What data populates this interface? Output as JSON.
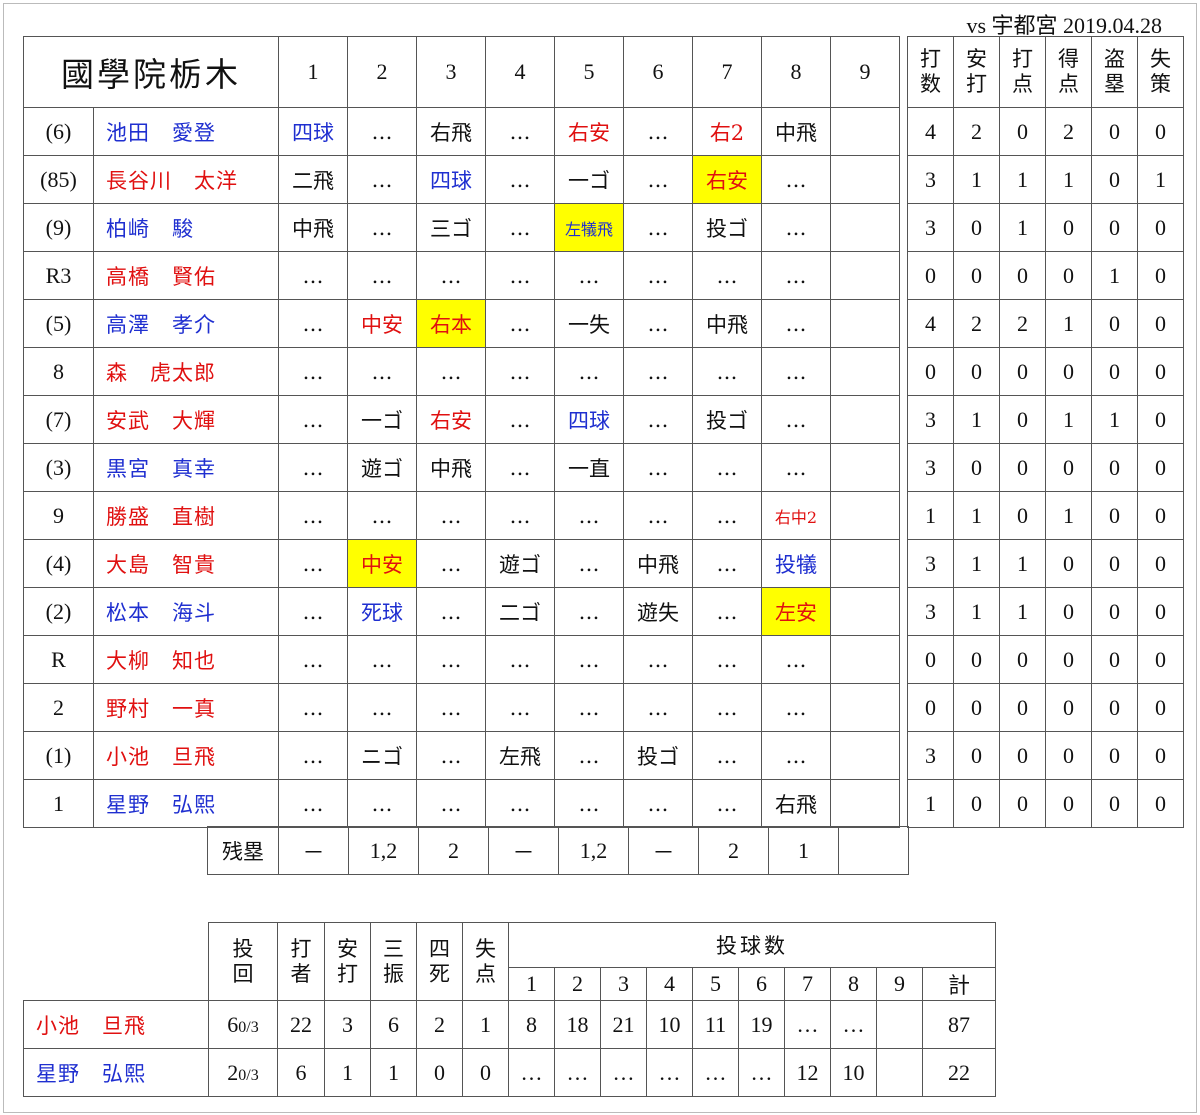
{
  "caption": "vs 宇都宮  2019.04.28",
  "team_name": "國學院栃木",
  "inning_headers": [
    "1",
    "2",
    "3",
    "4",
    "5",
    "6",
    "7",
    "8",
    "9"
  ],
  "stat_headers": [
    "打\n数",
    "安\n打",
    "打\n点",
    "得\n点",
    "盗\n塁",
    "失\n策"
  ],
  "players": [
    {
      "pos": "(6)",
      "name": "池田　愛登",
      "name_color": "b",
      "innings": [
        [
          "四球",
          "b",
          false
        ],
        [
          "…",
          "",
          false
        ],
        [
          "右飛",
          "",
          false
        ],
        [
          "…",
          "",
          false
        ],
        [
          "右安",
          "r",
          false
        ],
        [
          "…",
          "",
          false
        ],
        [
          "右2",
          "r",
          false
        ],
        [
          "中飛",
          "",
          false
        ],
        [
          "",
          "",
          false
        ]
      ],
      "stats": [
        "4",
        "2",
        "0",
        "2",
        "0",
        "0"
      ]
    },
    {
      "pos": "(85)",
      "name": "長谷川　太洋",
      "name_color": "r",
      "innings": [
        [
          "二飛",
          "",
          false
        ],
        [
          "…",
          "",
          false
        ],
        [
          "四球",
          "b",
          false
        ],
        [
          "…",
          "",
          false
        ],
        [
          "一ゴ",
          "",
          false
        ],
        [
          "…",
          "",
          false
        ],
        [
          "右安",
          "r",
          true
        ],
        [
          "…",
          "",
          false
        ],
        [
          "",
          "",
          false
        ]
      ],
      "stats": [
        "3",
        "1",
        "1",
        "1",
        "0",
        "1"
      ]
    },
    {
      "pos": "(9)",
      "name": "柏崎　駿",
      "name_color": "b",
      "innings": [
        [
          "中飛",
          "",
          false
        ],
        [
          "…",
          "",
          false
        ],
        [
          "三ゴ",
          "",
          false
        ],
        [
          "…",
          "",
          false
        ],
        [
          "左犠飛",
          "b",
          true
        ],
        [
          "…",
          "",
          false
        ],
        [
          "投ゴ",
          "",
          false
        ],
        [
          "…",
          "",
          false
        ],
        [
          "",
          "",
          false
        ]
      ],
      "stats": [
        "3",
        "0",
        "1",
        "0",
        "0",
        "0"
      ]
    },
    {
      "pos": "R3",
      "name": "高橋　賢佑",
      "name_color": "r",
      "innings": [
        [
          "…",
          "",
          false
        ],
        [
          "…",
          "",
          false
        ],
        [
          "…",
          "",
          false
        ],
        [
          "…",
          "",
          false
        ],
        [
          "…",
          "",
          false
        ],
        [
          "…",
          "",
          false
        ],
        [
          "…",
          "",
          false
        ],
        [
          "…",
          "",
          false
        ],
        [
          "",
          "",
          false
        ]
      ],
      "stats": [
        "0",
        "0",
        "0",
        "0",
        "1",
        "0"
      ]
    },
    {
      "pos": "(5)",
      "name": "高澤　孝介",
      "name_color": "b",
      "innings": [
        [
          "…",
          "",
          false
        ],
        [
          "中安",
          "r",
          false
        ],
        [
          "右本",
          "r",
          true
        ],
        [
          "…",
          "",
          false
        ],
        [
          "一失",
          "",
          false
        ],
        [
          "…",
          "",
          false
        ],
        [
          "中飛",
          "",
          false
        ],
        [
          "…",
          "",
          false
        ],
        [
          "",
          "",
          false
        ]
      ],
      "stats": [
        "4",
        "2",
        "2",
        "1",
        "0",
        "0"
      ]
    },
    {
      "pos": "8",
      "name": "森　虎太郎",
      "name_color": "r",
      "innings": [
        [
          "…",
          "",
          false
        ],
        [
          "…",
          "",
          false
        ],
        [
          "…",
          "",
          false
        ],
        [
          "…",
          "",
          false
        ],
        [
          "…",
          "",
          false
        ],
        [
          "…",
          "",
          false
        ],
        [
          "…",
          "",
          false
        ],
        [
          "…",
          "",
          false
        ],
        [
          "",
          "",
          false
        ]
      ],
      "stats": [
        "0",
        "0",
        "0",
        "0",
        "0",
        "0"
      ]
    },
    {
      "pos": "(7)",
      "name": "安武　大輝",
      "name_color": "r",
      "innings": [
        [
          "…",
          "",
          false
        ],
        [
          "一ゴ",
          "",
          false
        ],
        [
          "右安",
          "r",
          false
        ],
        [
          "…",
          "",
          false
        ],
        [
          "四球",
          "b",
          false
        ],
        [
          "…",
          "",
          false
        ],
        [
          "投ゴ",
          "",
          false
        ],
        [
          "…",
          "",
          false
        ],
        [
          "",
          "",
          false
        ]
      ],
      "stats": [
        "3",
        "1",
        "0",
        "1",
        "1",
        "0"
      ]
    },
    {
      "pos": "(3)",
      "name": "黒宮　真幸",
      "name_color": "b",
      "innings": [
        [
          "…",
          "",
          false
        ],
        [
          "遊ゴ",
          "",
          false
        ],
        [
          "中飛",
          "",
          false
        ],
        [
          "…",
          "",
          false
        ],
        [
          "一直",
          "",
          false
        ],
        [
          "…",
          "",
          false
        ],
        [
          "…",
          "",
          false
        ],
        [
          "…",
          "",
          false
        ],
        [
          "",
          "",
          false
        ]
      ],
      "stats": [
        "3",
        "0",
        "0",
        "0",
        "0",
        "0"
      ]
    },
    {
      "pos": "9",
      "name": "勝盛　直樹",
      "name_color": "r",
      "innings": [
        [
          "…",
          "",
          false
        ],
        [
          "…",
          "",
          false
        ],
        [
          "…",
          "",
          false
        ],
        [
          "…",
          "",
          false
        ],
        [
          "…",
          "",
          false
        ],
        [
          "…",
          "",
          false
        ],
        [
          "…",
          "",
          false
        ],
        [
          "右中2",
          "r",
          false
        ],
        [
          "",
          "",
          false
        ]
      ],
      "stats": [
        "1",
        "1",
        "0",
        "1",
        "0",
        "0"
      ]
    },
    {
      "pos": "(4)",
      "name": "大島　智貴",
      "name_color": "r",
      "innings": [
        [
          "…",
          "",
          false
        ],
        [
          "中安",
          "r",
          true
        ],
        [
          "…",
          "",
          false
        ],
        [
          "遊ゴ",
          "",
          false
        ],
        [
          "…",
          "",
          false
        ],
        [
          "中飛",
          "",
          false
        ],
        [
          "…",
          "",
          false
        ],
        [
          "投犠",
          "b",
          false
        ],
        [
          "",
          "",
          false
        ]
      ],
      "stats": [
        "3",
        "1",
        "1",
        "0",
        "0",
        "0"
      ]
    },
    {
      "pos": "(2)",
      "name": "松本　海斗",
      "name_color": "b",
      "innings": [
        [
          "…",
          "",
          false
        ],
        [
          "死球",
          "b",
          false
        ],
        [
          "…",
          "",
          false
        ],
        [
          "二ゴ",
          "",
          false
        ],
        [
          "…",
          "",
          false
        ],
        [
          "遊失",
          "",
          false
        ],
        [
          "…",
          "",
          false
        ],
        [
          "左安",
          "r",
          true
        ],
        [
          "",
          "",
          false
        ]
      ],
      "stats": [
        "3",
        "1",
        "1",
        "0",
        "0",
        "0"
      ]
    },
    {
      "pos": "R",
      "name": "大柳　知也",
      "name_color": "r",
      "innings": [
        [
          "…",
          "",
          false
        ],
        [
          "…",
          "",
          false
        ],
        [
          "…",
          "",
          false
        ],
        [
          "…",
          "",
          false
        ],
        [
          "…",
          "",
          false
        ],
        [
          "…",
          "",
          false
        ],
        [
          "…",
          "",
          false
        ],
        [
          "…",
          "",
          false
        ],
        [
          "",
          "",
          false
        ]
      ],
      "stats": [
        "0",
        "0",
        "0",
        "0",
        "0",
        "0"
      ]
    },
    {
      "pos": "2",
      "name": "野村　一真",
      "name_color": "r",
      "innings": [
        [
          "…",
          "",
          false
        ],
        [
          "…",
          "",
          false
        ],
        [
          "…",
          "",
          false
        ],
        [
          "…",
          "",
          false
        ],
        [
          "…",
          "",
          false
        ],
        [
          "…",
          "",
          false
        ],
        [
          "…",
          "",
          false
        ],
        [
          "…",
          "",
          false
        ],
        [
          "",
          "",
          false
        ]
      ],
      "stats": [
        "0",
        "0",
        "0",
        "0",
        "0",
        "0"
      ]
    },
    {
      "pos": "(1)",
      "name": "小池　旦飛",
      "name_color": "r",
      "innings": [
        [
          "…",
          "",
          false
        ],
        [
          "ニゴ",
          "",
          false
        ],
        [
          "…",
          "",
          false
        ],
        [
          "左飛",
          "",
          false
        ],
        [
          "…",
          "",
          false
        ],
        [
          "投ゴ",
          "",
          false
        ],
        [
          "…",
          "",
          false
        ],
        [
          "…",
          "",
          false
        ],
        [
          "",
          "",
          false
        ]
      ],
      "stats": [
        "3",
        "0",
        "0",
        "0",
        "0",
        "0"
      ]
    },
    {
      "pos": "1",
      "name": "星野　弘熙",
      "name_color": "b",
      "innings": [
        [
          "…",
          "",
          false
        ],
        [
          "…",
          "",
          false
        ],
        [
          "…",
          "",
          false
        ],
        [
          "…",
          "",
          false
        ],
        [
          "…",
          "",
          false
        ],
        [
          "…",
          "",
          false
        ],
        [
          "…",
          "",
          false
        ],
        [
          "右飛",
          "",
          false
        ],
        [
          "",
          "",
          false
        ]
      ],
      "stats": [
        "1",
        "0",
        "0",
        "0",
        "0",
        "0"
      ]
    }
  ],
  "lob": {
    "label": "残塁",
    "values": [
      "－",
      "1,2",
      "2",
      "－",
      "1,2",
      "－",
      "2",
      "1",
      ""
    ]
  },
  "pitching": {
    "headers": [
      "投\n回",
      "打\n者",
      "安\n打",
      "三\n振",
      "四\n死",
      "失\n点"
    ],
    "pitch_count_label": "投球数",
    "innings": [
      "1",
      "2",
      "3",
      "4",
      "5",
      "6",
      "7",
      "8",
      "9",
      "計"
    ],
    "rows": [
      {
        "name": "小池　旦飛",
        "name_color": "r",
        "ip_whole": "6",
        "ip_frac": "0/3",
        "stats": [
          "22",
          "3",
          "6",
          "2",
          "1"
        ],
        "counts": [
          "8",
          "18",
          "21",
          "10",
          "11",
          "19",
          "…",
          "…",
          "",
          "87"
        ]
      },
      {
        "name": "星野　弘熙",
        "name_color": "b",
        "ip_whole": "2",
        "ip_frac": "0/3",
        "stats": [
          "6",
          "1",
          "1",
          "0",
          "0"
        ],
        "counts": [
          "…",
          "…",
          "…",
          "…",
          "…",
          "…",
          "12",
          "10",
          "",
          "22"
        ]
      }
    ]
  }
}
